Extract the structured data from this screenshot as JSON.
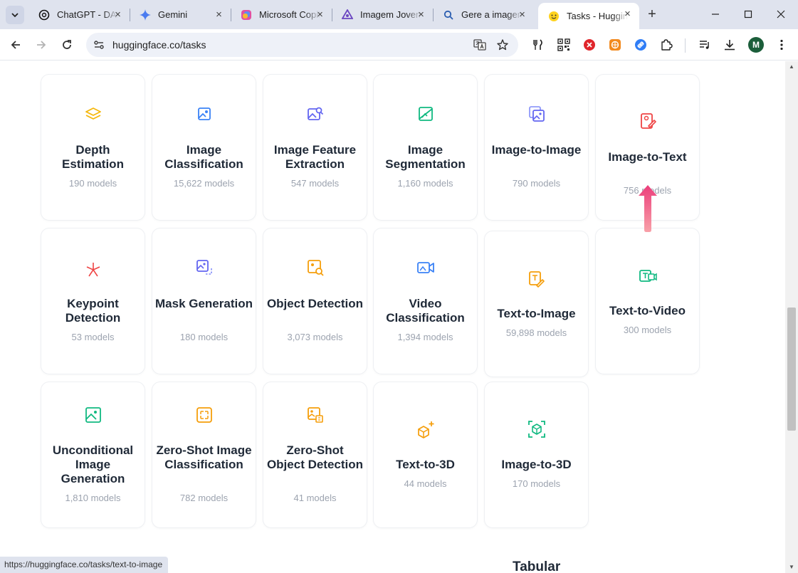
{
  "browser": {
    "tabs": [
      {
        "title": "ChatGPT - DALL·E",
        "icon": "openai-icon"
      },
      {
        "title": "Gemini",
        "icon": "gemini-icon"
      },
      {
        "title": "Microsoft Copilot",
        "icon": "copilot-icon"
      },
      {
        "title": "Imagem Jovem",
        "icon": "app-icon"
      },
      {
        "title": "Gere a imagem",
        "icon": "search-icon"
      },
      {
        "title": "Tasks - Hugging Face",
        "icon": "hugging-face-icon"
      }
    ],
    "url": "huggingface.co/tasks",
    "avatar_letter": "M",
    "status_url": "https://huggingface.co/tasks/text-to-image"
  },
  "page": {
    "tasks": [
      {
        "name": "Depth Estimation",
        "count": "190 models",
        "color": "#f59e0b"
      },
      {
        "name": "Image Classification",
        "count": "15,622 models",
        "color": "#3b82f6"
      },
      {
        "name": "Image Feature Extraction",
        "count": "547 models",
        "color": "#6366f1"
      },
      {
        "name": "Image Segmentation",
        "count": "1,160 models",
        "color": "#10b981"
      },
      {
        "name": "Image-to-Image",
        "count": "790 models",
        "color": "#6366f1"
      },
      {
        "name": "Image-to-Text",
        "count": "756 models",
        "color": "#ef4444"
      },
      {
        "name": "Keypoint Detection",
        "count": "53 models",
        "color": "#ef4444"
      },
      {
        "name": "Mask Generation",
        "count": "180 models",
        "color": "#6366f1"
      },
      {
        "name": "Object Detection",
        "count": "3,073 models",
        "color": "#f59e0b"
      },
      {
        "name": "Video Classification",
        "count": "1,394 models",
        "color": "#3b82f6"
      },
      {
        "name": "Text-to-Image",
        "count": "59,898 models",
        "color": "#f59e0b"
      },
      {
        "name": "Text-to-Video",
        "count": "300 models",
        "color": "#10b981"
      },
      {
        "name": "Unconditional Image Generation",
        "count": "1,810 models",
        "color": "#10b981"
      },
      {
        "name": "Zero-Shot Image Classification",
        "count": "782 models",
        "color": "#f59e0b"
      },
      {
        "name": "Zero-Shot Object Detection",
        "count": "41 models",
        "color": "#f59e0b"
      },
      {
        "name": "Text-to-3D",
        "count": "44 models",
        "color": "#f59e0b"
      },
      {
        "name": "Image-to-3D",
        "count": "170 models",
        "color": "#10b981"
      }
    ],
    "next_section": "Tabular"
  }
}
